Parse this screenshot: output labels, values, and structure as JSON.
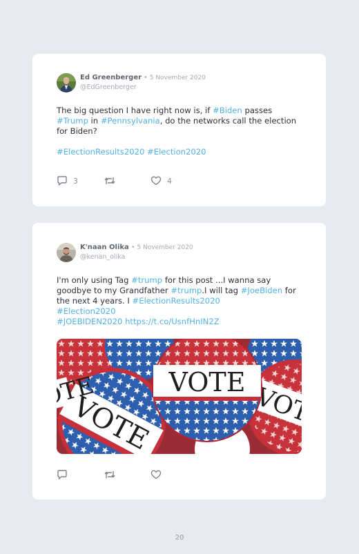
{
  "posts": [
    {
      "author": "Ed Greenberger",
      "separator": "•",
      "date": "5 November 2020",
      "handle": "@EdGreenberger",
      "body": [
        {
          "t": "The big question I have right now is, if ",
          "tag": false
        },
        {
          "t": "#Biden",
          "tag": true
        },
        {
          "t": " passes ",
          "tag": false
        },
        {
          "t": "#Trump",
          "tag": true
        },
        {
          "t": " in ",
          "tag": false
        },
        {
          "t": "#Pennsylvania",
          "tag": true
        },
        {
          "t": ", do the networks call the election for Biden?",
          "tag": false
        }
      ],
      "hashtags": [
        "#ElectionResults2020",
        "#Election2020"
      ],
      "reply_icon": "reply-icon",
      "retweet_icon": "retweet-icon",
      "like_icon": "heart-icon",
      "replies": "3",
      "likes": "4"
    },
    {
      "author": "K'naan Olika",
      "separator": "•",
      "date": "5 November 2020",
      "handle": "@kenan_olika",
      "body": [
        {
          "t": "I'm only using Tag ",
          "tag": false
        },
        {
          "t": "#trump",
          "tag": true
        },
        {
          "t": " for this post ...I wanna say goodbye to my Grandfather ",
          "tag": false
        },
        {
          "t": "#trump",
          "tag": true
        },
        {
          "t": ".I will tag ",
          "tag": false
        },
        {
          "t": "#JoeBiden",
          "tag": true
        },
        {
          "t": " for the next 4 years. I ",
          "tag": false
        },
        {
          "t": "#ElectionResults2020",
          "tag": true
        },
        {
          "t": "\n",
          "tag": false
        },
        {
          "t": "#Election2020",
          "tag": true
        },
        {
          "t": "\n",
          "tag": false
        },
        {
          "t": "#JOEBIDEN2020",
          "tag": true
        },
        {
          "t": " ",
          "tag": false
        },
        {
          "t": "https://t.co/UsnfHnIN2Z",
          "tag": true
        }
      ],
      "image_text": [
        "VOTE",
        "VOTE",
        "VOTE",
        "VOTE"
      ],
      "reply_icon": "reply-icon",
      "retweet_icon": "retweet-icon",
      "like_icon": "heart-icon"
    }
  ],
  "page_number": "20",
  "colors": {
    "background": "#e7eaef",
    "card": "#ffffff",
    "link": "#52b1e6",
    "text": "#2b2f36",
    "muted": "#a4aab3"
  }
}
